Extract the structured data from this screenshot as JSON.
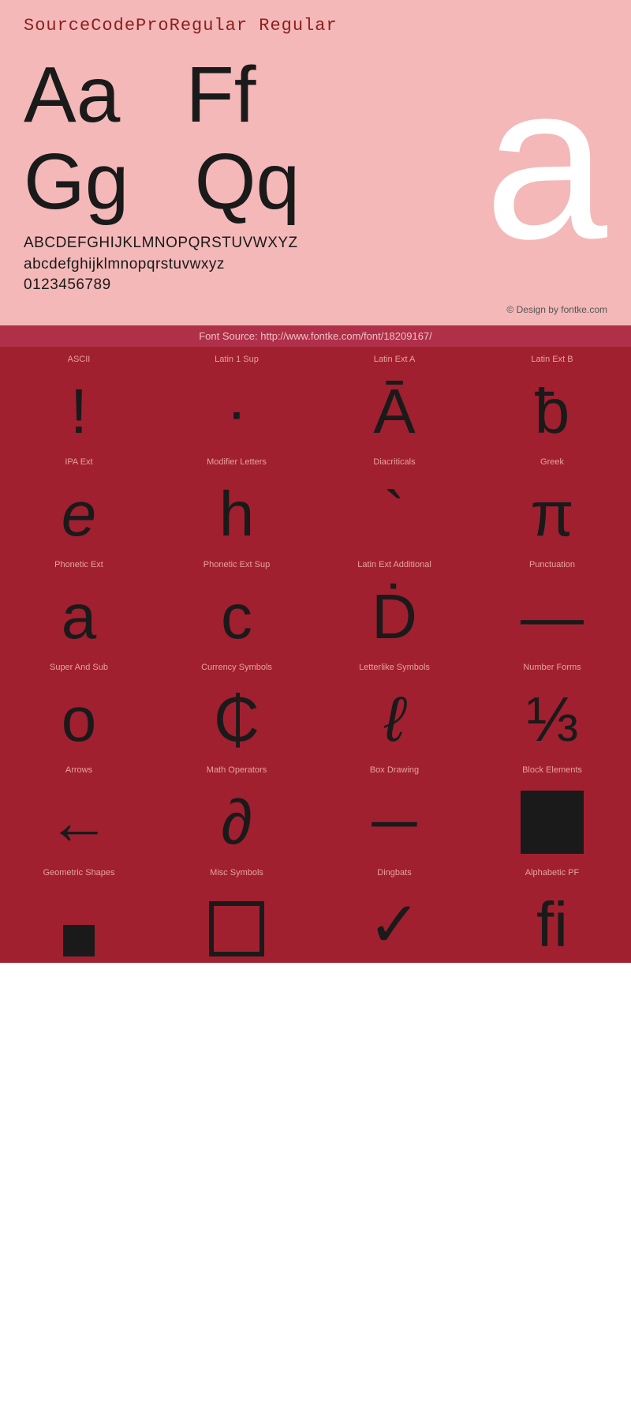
{
  "header": {
    "title": "SourceCodeProRegular Regular",
    "title_color": "#8b2020"
  },
  "specimen": {
    "letters_row1": "Aa  Ff",
    "letters_row2": "Gg  Qq",
    "big_letter": "a",
    "uppercase": "ABCDEFGHIJKLMNOPQRSTUVWXYZ",
    "lowercase": "abcdefghijklmnopqrstuvwxyz",
    "digits": "0123456789",
    "copyright": "© Design by fontke.com",
    "source": "Font Source: http://www.fontke.com/font/18209167/"
  },
  "grid": {
    "rows": [
      {
        "cells": [
          {
            "label": "ASCII",
            "glyph": "!",
            "size": "big"
          },
          {
            "label": "Latin 1 Sup",
            "glyph": "·",
            "size": "big"
          },
          {
            "label": "Latin Ext A",
            "glyph": "Ā",
            "size": "big"
          },
          {
            "label": "Latin Ext B",
            "glyph": "ƀ",
            "size": "big"
          }
        ]
      },
      {
        "cells": [
          {
            "label": "IPA Ext",
            "glyph": "e",
            "size": "big"
          },
          {
            "label": "Modifier Letters",
            "glyph": "h",
            "size": "big"
          },
          {
            "label": "Diacriticals",
            "glyph": "`",
            "size": "big"
          },
          {
            "label": "Greek",
            "glyph": "π",
            "size": "big"
          }
        ]
      },
      {
        "cells": [
          {
            "label": "Phonetic Ext",
            "glyph": "a",
            "size": "big"
          },
          {
            "label": "Phonetic Ext Sup",
            "glyph": "c",
            "size": "big"
          },
          {
            "label": "Latin Ext Additional",
            "glyph": "Ḋ",
            "size": "big"
          },
          {
            "label": "Punctuation",
            "glyph": "—",
            "size": "big"
          }
        ]
      },
      {
        "cells": [
          {
            "label": "Super And Sub",
            "glyph": "o",
            "size": "big"
          },
          {
            "label": "Currency Symbols",
            "glyph": "₵",
            "size": "big"
          },
          {
            "label": "Letterlike Symbols",
            "glyph": "ℓ",
            "size": "big"
          },
          {
            "label": "Number Forms",
            "glyph": "⅓",
            "size": "big"
          }
        ]
      },
      {
        "cells": [
          {
            "label": "Arrows",
            "glyph": "←",
            "size": "big"
          },
          {
            "label": "Math Operators",
            "glyph": "∂",
            "size": "big"
          },
          {
            "label": "Box Drawing",
            "glyph": "─",
            "size": "big"
          },
          {
            "label": "Block Elements",
            "glyph": "■",
            "size": "block"
          }
        ]
      },
      {
        "cells": [
          {
            "label": "Geometric Shapes",
            "glyph": "▪",
            "size": "small"
          },
          {
            "label": "Misc Symbols",
            "glyph": "□",
            "size": "outline"
          },
          {
            "label": "Dingbats",
            "glyph": "✓",
            "size": "big"
          },
          {
            "label": "Alphabetic PF",
            "glyph": "ﬁ",
            "size": "big"
          }
        ]
      }
    ]
  }
}
